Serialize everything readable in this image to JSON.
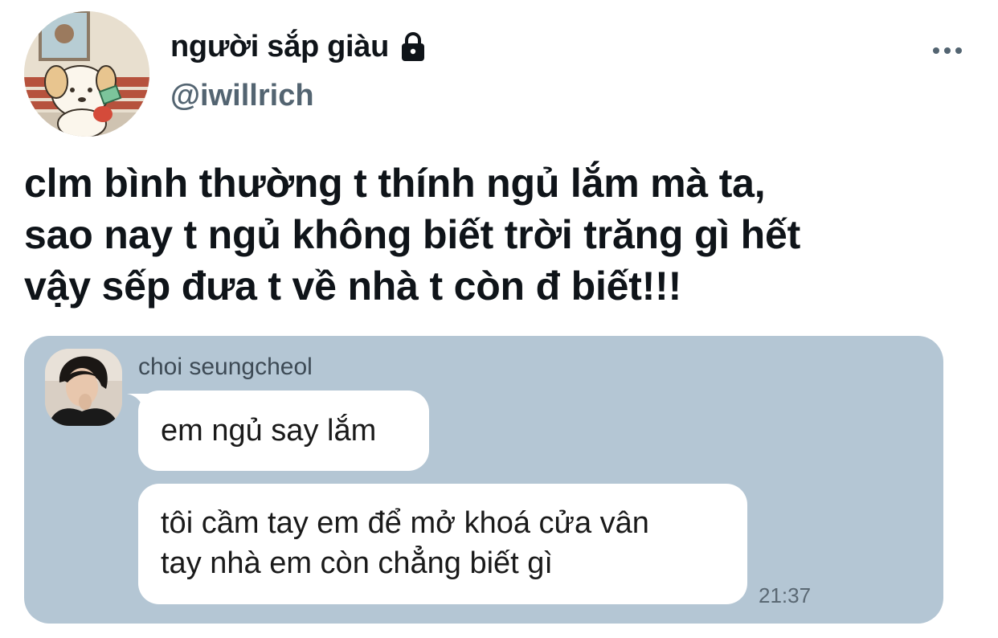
{
  "author": {
    "display_name": "người sắp giàu",
    "handle": "@iwillrich",
    "avatar_icon": "cartoon-dog-avatar",
    "protected_icon": "lock-icon"
  },
  "more_icon": "more-horizontal-icon",
  "tweet": {
    "lines": [
      "clm bình thường t thính ngủ lắm mà ta,",
      "sao nay t ngủ không biết trời trăng gì hết",
      "vậy sếp đưa t về nhà t còn đ biết!!!"
    ]
  },
  "chat": {
    "background": "#b4c6d4",
    "sender_name": "choi seungcheol",
    "sender_avatar_icon": "person-photo-avatar",
    "messages": [
      {
        "lines": [
          "em ngủ say lắm"
        ]
      },
      {
        "lines": [
          "tôi cầm tay em để mở khoá cửa vân",
          "tay nhà em còn chẳng biết gì"
        ]
      }
    ],
    "time": "21:37"
  }
}
